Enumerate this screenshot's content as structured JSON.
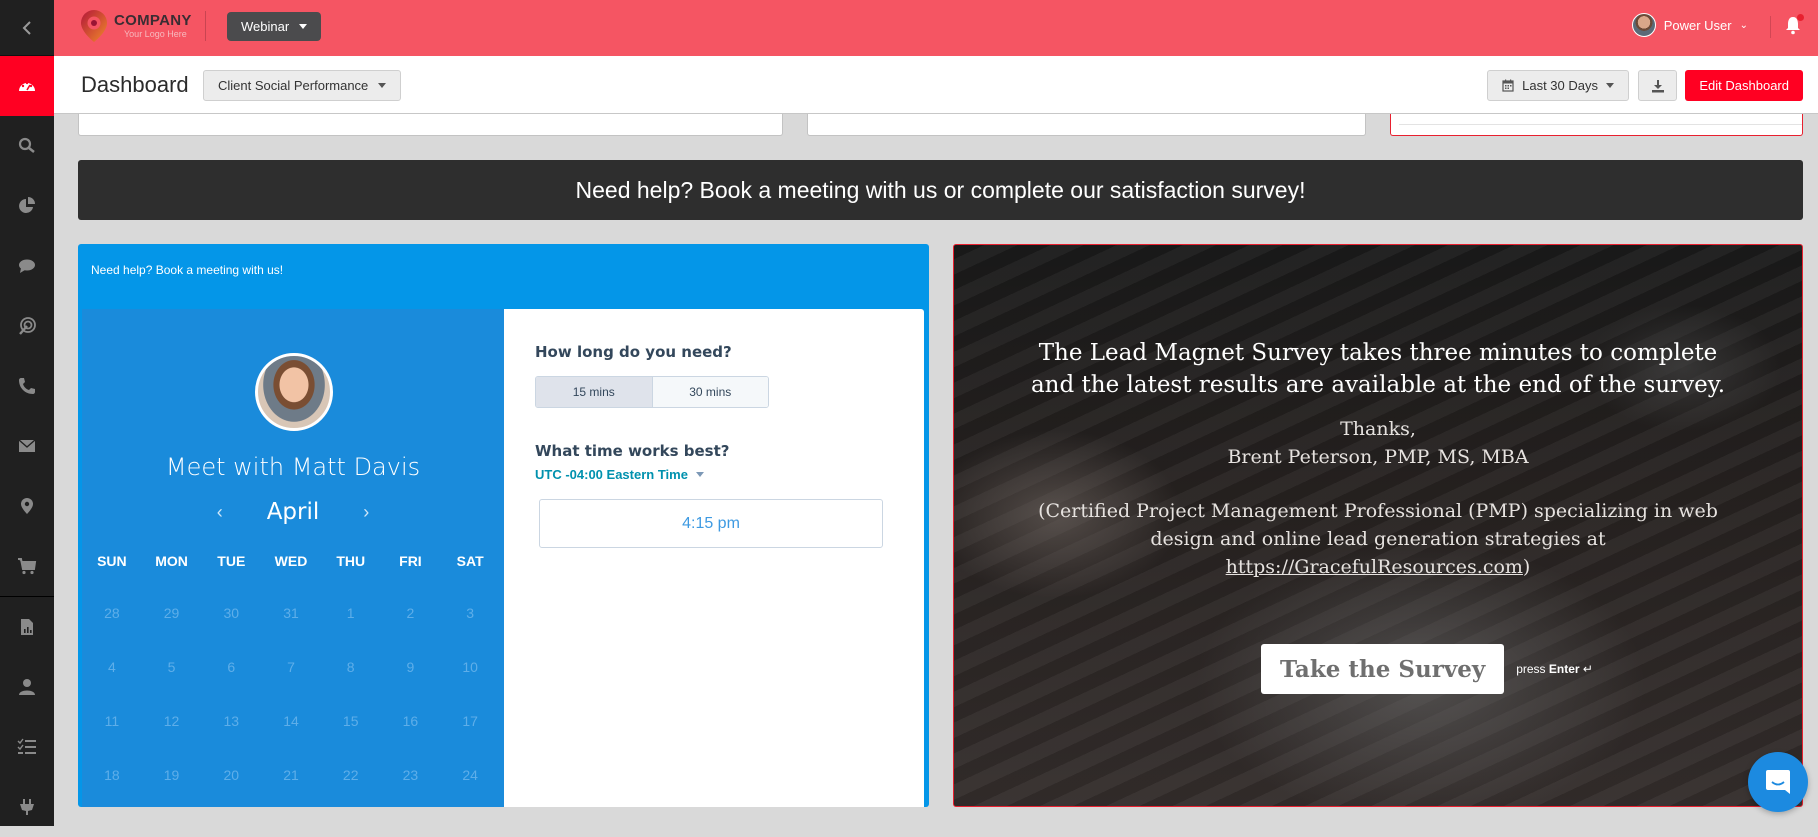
{
  "app": {
    "logo": {
      "name": "COMPANY",
      "tagline": "Your Logo Here"
    },
    "workspace_selector": {
      "label": "Webinar"
    },
    "user": {
      "name": "Power User"
    },
    "notifications": {
      "has_unread": true
    }
  },
  "sidebar": {
    "collapse_icon": "chevron-left-icon",
    "items": [
      {
        "icon": "dashboard-icon",
        "active": true
      },
      {
        "icon": "search-icon",
        "active": false
      },
      {
        "icon": "pie-chart-icon",
        "active": false
      },
      {
        "icon": "chat-bubble-icon",
        "active": false
      },
      {
        "icon": "target-icon",
        "active": false
      },
      {
        "icon": "phone-icon",
        "active": false
      },
      {
        "icon": "envelope-icon",
        "active": false
      },
      {
        "icon": "map-pin-icon",
        "active": false
      },
      {
        "icon": "cart-icon",
        "active": false
      },
      {
        "icon": "report-icon",
        "active": false
      },
      {
        "icon": "user-icon",
        "active": false
      },
      {
        "icon": "checklist-icon",
        "active": false
      },
      {
        "icon": "plug-icon",
        "active": false
      }
    ]
  },
  "subheader": {
    "title": "Dashboard",
    "dashboard_select": "Client Social Performance",
    "date_range": "Last 30 Days",
    "download_icon": "download-icon",
    "edit_label": "Edit Dashboard"
  },
  "banner": {
    "text": "Need help? Book a meeting with us or complete our satisfaction survey!"
  },
  "meeting_widget": {
    "title": "Need help? Book a meeting with us!",
    "host": "Meet with Matt Davis",
    "month": "April",
    "prev_icon": "‹",
    "next_icon": "›",
    "weekdays": [
      "SUN",
      "MON",
      "TUE",
      "WED",
      "THU",
      "FRI",
      "SAT"
    ],
    "weeks": [
      [
        "28",
        "29",
        "30",
        "31",
        "1",
        "2",
        "3"
      ],
      [
        "4",
        "5",
        "6",
        "7",
        "8",
        "9",
        "10"
      ],
      [
        "11",
        "12",
        "13",
        "14",
        "15",
        "16",
        "17"
      ],
      [
        "18",
        "19",
        "20",
        "21",
        "22",
        "23",
        "24"
      ]
    ],
    "duration_question": "How long do you need?",
    "durations": [
      {
        "label": "15 mins",
        "selected": true
      },
      {
        "label": "30 mins",
        "selected": false
      }
    ],
    "time_question": "What time works best?",
    "timezone": "UTC -04:00 Eastern Time",
    "time_slots": [
      "4:15 pm"
    ]
  },
  "survey": {
    "lead_line1": "The Lead Magnet Survey takes three minutes to complete",
    "lead_line2": "and the latest results are available at the end of the survey.",
    "thanks": "Thanks,",
    "signature": "Brent Peterson, PMP, MS, MBA",
    "bio_prefix": "(Certified Project Management Professional (PMP) specializing in web design and online lead generation strategies at ",
    "bio_link": "https://GracefulResources.com",
    "bio_suffix": ")",
    "cta_label": "Take the Survey",
    "hint_prefix": "press",
    "hint_key": "Enter",
    "hint_icon": "↵"
  },
  "colors": {
    "brand_red": "#ff0022",
    "topbar": "#f55563",
    "meeting_blue": "#0496e8",
    "timezone_teal": "#0091ae"
  }
}
